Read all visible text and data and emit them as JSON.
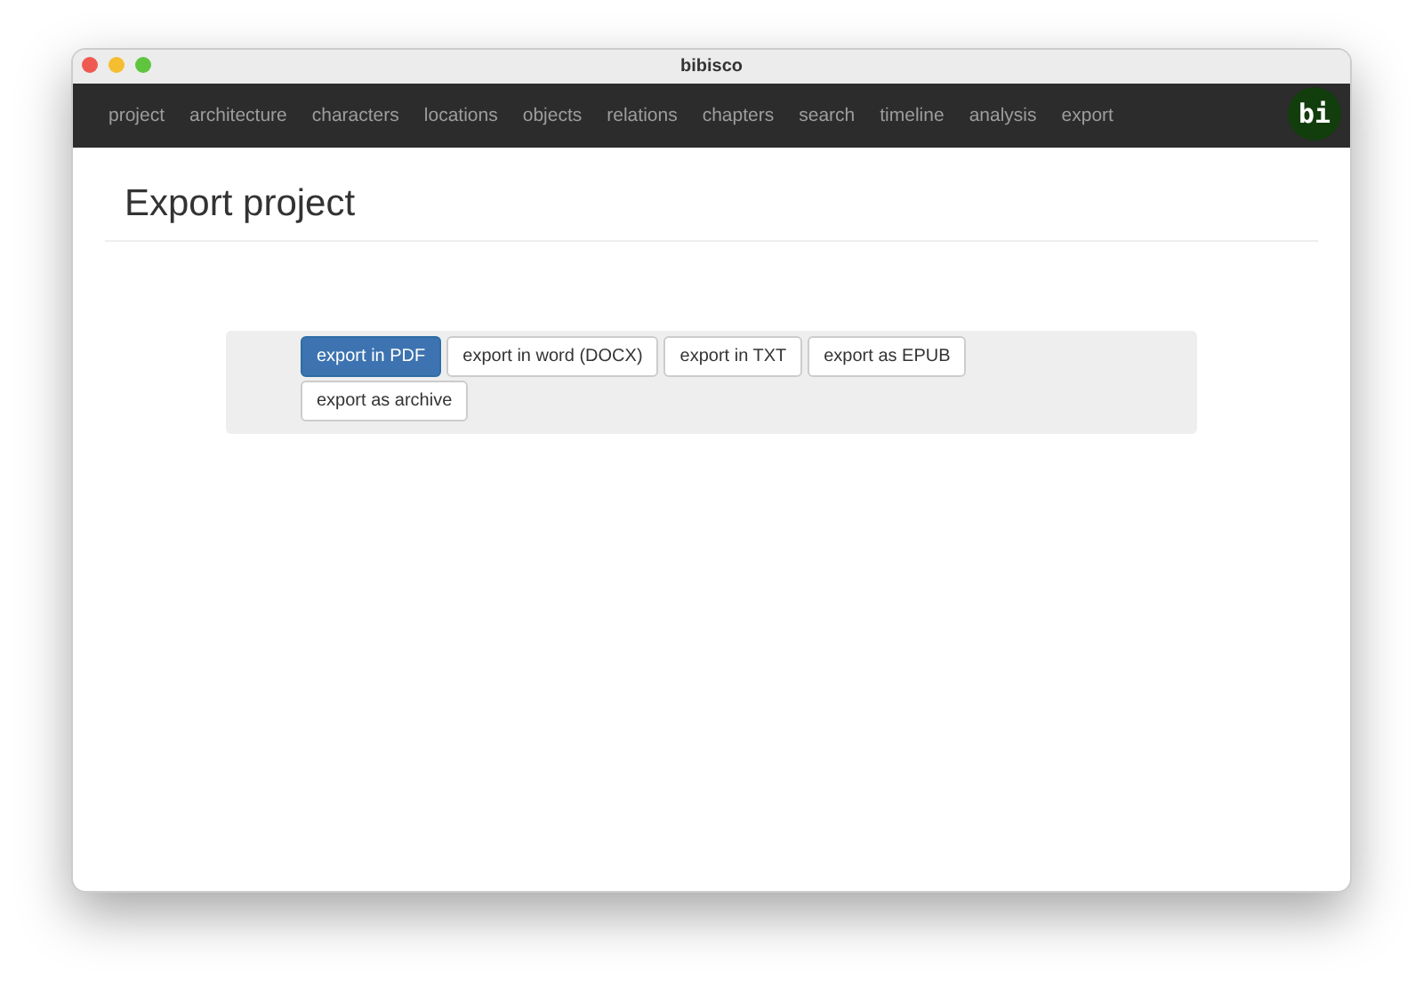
{
  "window": {
    "title": "bibisco"
  },
  "nav": {
    "items": [
      {
        "label": "project"
      },
      {
        "label": "architecture"
      },
      {
        "label": "characters"
      },
      {
        "label": "locations"
      },
      {
        "label": "objects"
      },
      {
        "label": "relations"
      },
      {
        "label": "chapters"
      },
      {
        "label": "search"
      },
      {
        "label": "timeline"
      },
      {
        "label": "analysis"
      },
      {
        "label": "export"
      }
    ],
    "logo": "bi"
  },
  "page": {
    "title": "Export project"
  },
  "export_buttons": [
    {
      "label": "export in PDF",
      "selected": true
    },
    {
      "label": "export in word (DOCX)",
      "selected": false
    },
    {
      "label": "export in TXT",
      "selected": false
    },
    {
      "label": "export as EPUB",
      "selected": false
    },
    {
      "label": "export as archive",
      "selected": false
    }
  ]
}
